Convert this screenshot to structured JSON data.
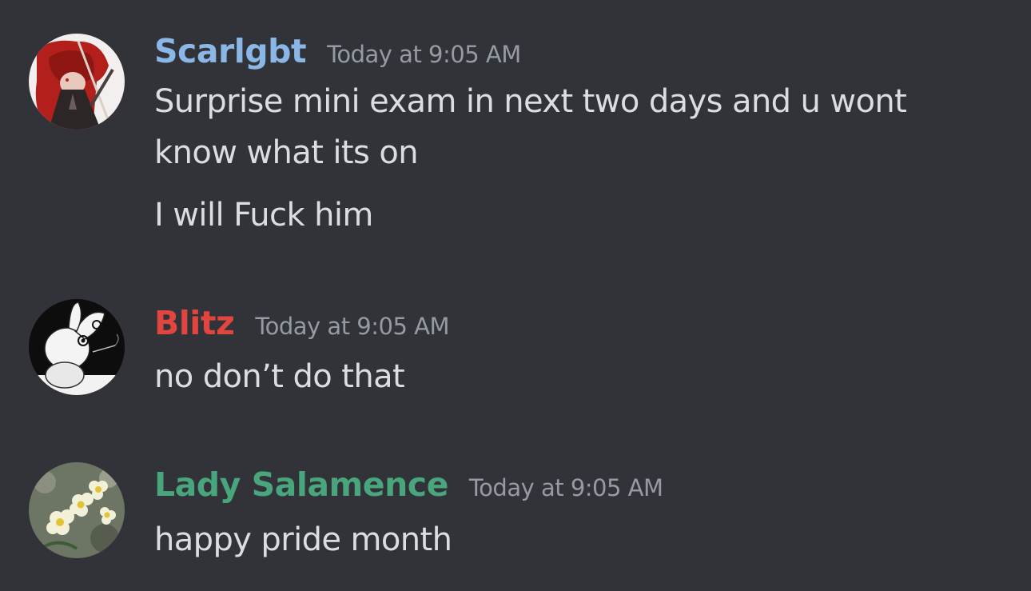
{
  "messages": [
    {
      "author": "Scarlgbt",
      "author_color": "#8ab7e6",
      "timestamp": "Today at 9:05 AM",
      "lines": [
        "Surprise mini exam in next two days and u wont",
        "know what its on",
        "I will Fuck him"
      ],
      "avatar_icon": "red-haired-character-avatar"
    },
    {
      "author": "Blitz",
      "author_color": "#e0453f",
      "timestamp": "Today at 9:05 AM",
      "lines": [
        "no don’t do that"
      ],
      "avatar_icon": "white-rabbit-avatar"
    },
    {
      "author": "Lady Salamence",
      "author_color": "#48a57c",
      "timestamp": "Today at 9:05 AM",
      "lines": [
        "happy pride month"
      ],
      "avatar_icon": "white-flowers-avatar"
    }
  ]
}
